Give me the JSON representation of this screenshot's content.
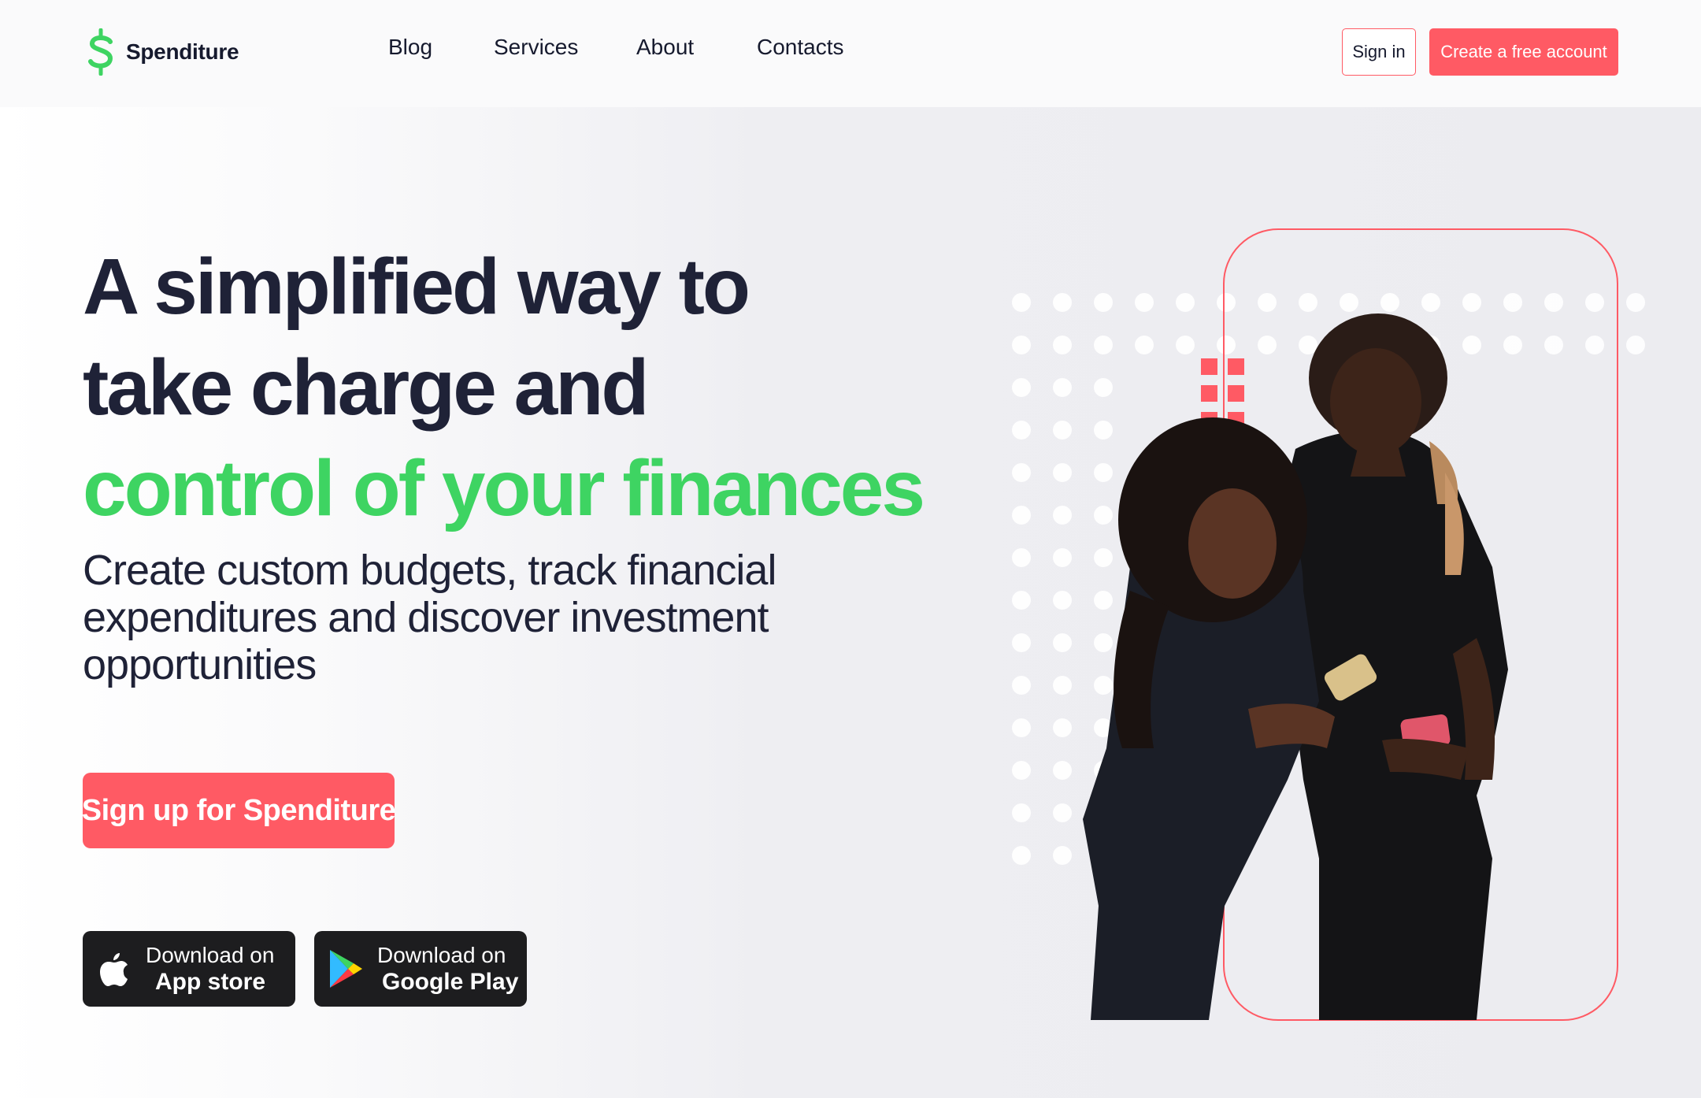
{
  "brand": {
    "name": "Spenditure",
    "logo_icon": "dollar-sign-icon",
    "accent_green": "#3ed462",
    "accent_red": "#ff5a64"
  },
  "nav": {
    "items": [
      "Blog",
      "Services",
      "About",
      "Contacts"
    ]
  },
  "header": {
    "signin_label": "Sign in",
    "create_label": "Create a free account"
  },
  "hero": {
    "headline_line1": "A simplified way to",
    "headline_line2": "take charge and",
    "headline_line3": "control of your finances",
    "subtitle": "Create custom budgets, track financial expenditures and discover investment opportunities",
    "cta_label": "Sign up for Spenditure"
  },
  "stores": [
    {
      "line1": "Download on",
      "line2": "App store",
      "icon": "apple-icon"
    },
    {
      "line1": "Download on",
      "line2": "Google Play",
      "icon": "google-play-icon"
    }
  ],
  "illustration": {
    "subject": "couple-looking-at-phones-photo"
  }
}
